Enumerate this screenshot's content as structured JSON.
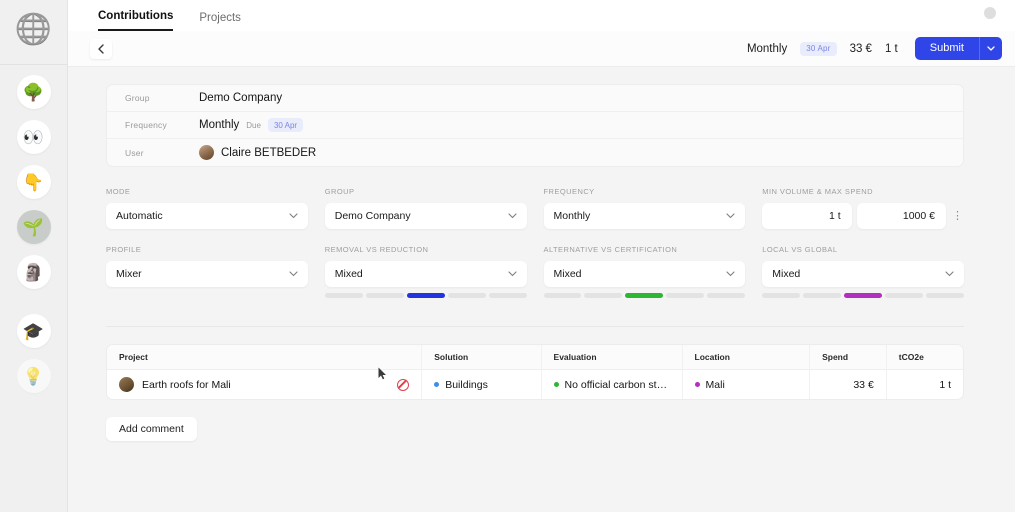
{
  "sidebar": {
    "logo_icon": "globe-logo",
    "items": [
      {
        "icon": "tree-icon",
        "glyph": "🌳",
        "active": false
      },
      {
        "icon": "eyes-icon",
        "glyph": "👀",
        "active": false
      },
      {
        "icon": "pointing-down-icon",
        "glyph": "👇",
        "active": false
      },
      {
        "icon": "seedling-icon",
        "glyph": "🌱",
        "active": true
      },
      {
        "icon": "moai-icon",
        "glyph": "🗿",
        "active": false
      },
      {
        "icon": "graduation-cap-icon",
        "glyph": "🎓",
        "active": false
      },
      {
        "icon": "light-bulb-icon",
        "glyph": "💡",
        "active": false
      }
    ]
  },
  "topbar": {
    "tabs": [
      {
        "label": "Contributions",
        "active": true
      },
      {
        "label": "Projects",
        "active": false
      }
    ]
  },
  "actionbar": {
    "back_icon": "chevron-left-icon",
    "frequency": "Monthly",
    "due_badge": "30 Apr",
    "spend": "33 €",
    "volume": "1 t",
    "submit_label": "Submit",
    "submit_caret_icon": "chevron-down-icon"
  },
  "info_card": {
    "rows": [
      {
        "label": "Group",
        "value": "Demo Company"
      },
      {
        "label": "Frequency",
        "value": "Monthly",
        "due_word": "Due",
        "due_badge": "30 Apr"
      },
      {
        "label": "User",
        "value": "Claire BETBEDER",
        "avatar": "user-avatar"
      }
    ]
  },
  "form": {
    "row1": [
      {
        "label": "MODE",
        "value": "Automatic",
        "type": "select"
      },
      {
        "label": "GROUP",
        "value": "Demo Company",
        "type": "select"
      },
      {
        "label": "FREQUENCY",
        "value": "Monthly",
        "type": "select"
      },
      {
        "label": "MIN VOLUME & MAX SPEND",
        "min_volume": "1 t",
        "max_spend": "1000 €",
        "type": "number-pair",
        "menu_icon": "vertical-dots-icon"
      }
    ],
    "row2": [
      {
        "label": "PROFILE",
        "value": "Mixer",
        "type": "select"
      },
      {
        "label": "REMOVAL VS REDUCTION",
        "value": "Mixed",
        "type": "select-slider",
        "segments": 5,
        "active_segment": 3,
        "color": "#2433e0"
      },
      {
        "label": "ALTERNATIVE VS CERTIFICATION",
        "value": "Mixed",
        "type": "select-slider",
        "segments": 5,
        "active_segment": 3,
        "color": "#2db633"
      },
      {
        "label": "LOCAL VS GLOBAL",
        "value": "Mixed",
        "type": "select-slider",
        "segments": 5,
        "active_segment": 3,
        "color": "#b22fbf"
      }
    ]
  },
  "table": {
    "headers": [
      "Project",
      "Solution",
      "Evaluation",
      "Location",
      "Spend",
      "tCO2e"
    ],
    "rows": [
      {
        "project": "Earth roofs for Mali",
        "project_action_icon": "block-icon",
        "solution": "Buildings",
        "solution_dot": "#3b8fe8",
        "evaluation": "No official carbon sta...",
        "evaluation_dot": "#2db633",
        "location": "Mali",
        "location_dot": "#b22fbf",
        "spend": "33 €",
        "tco2e": "1 t"
      }
    ]
  },
  "footer": {
    "add_comment_label": "Add comment"
  }
}
